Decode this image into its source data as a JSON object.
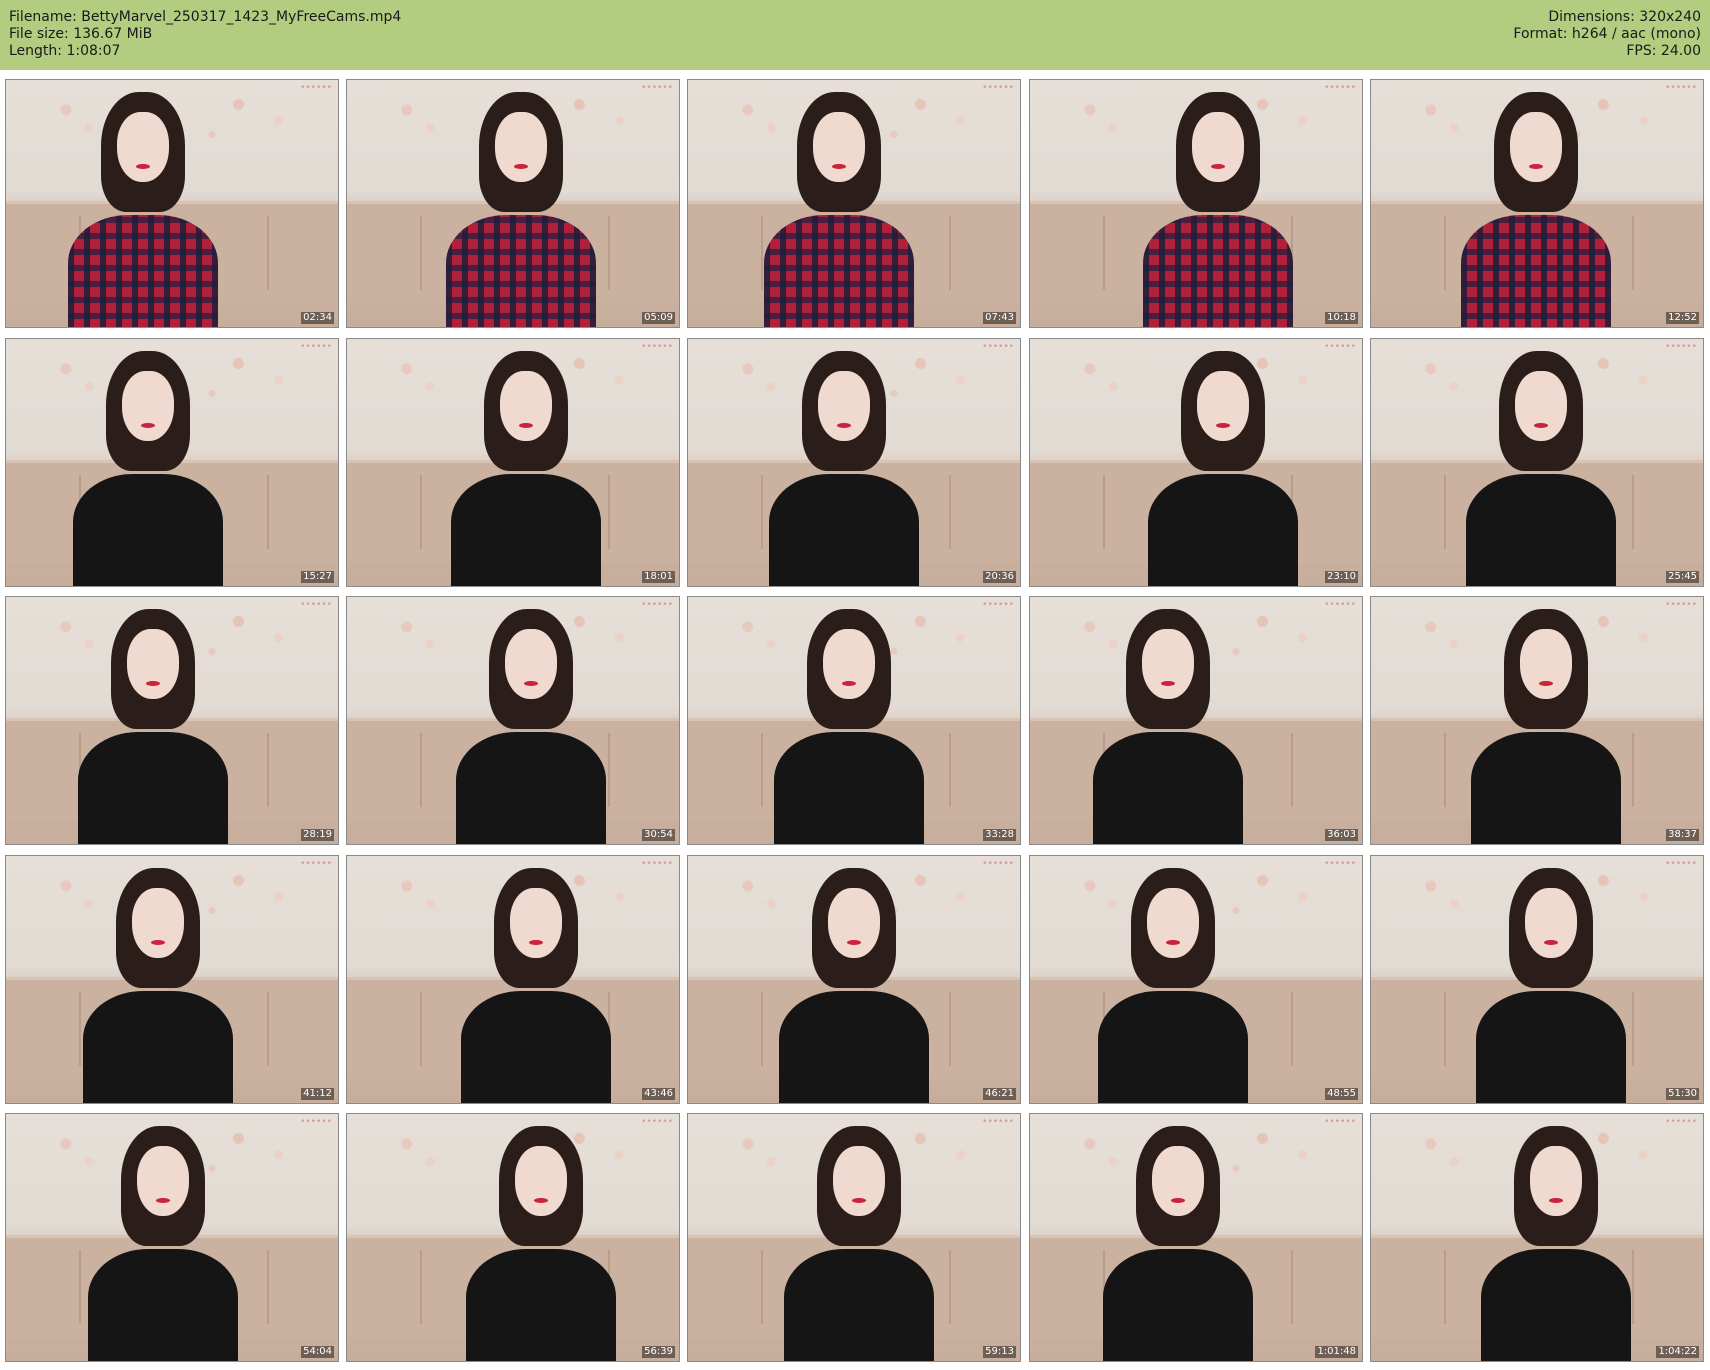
{
  "header": {
    "filename": "Filename: BettyMarvel_250317_1423_MyFreeCams.mp4",
    "file_size": "File size: 136.67 MiB",
    "length": "Length: 1:08:07",
    "dimensions": "Dimensions: 320x240",
    "format": "Format: h264 / aac (mono)",
    "fps": "FPS: 24.00"
  },
  "colors": {
    "header_bg": "#b2cd80",
    "page_bg": "#ffffff"
  },
  "thumbnails": [
    {
      "timestamp": "02:34",
      "outfit": "plaid"
    },
    {
      "timestamp": "05:09",
      "outfit": "plaid"
    },
    {
      "timestamp": "07:43",
      "outfit": "plaid"
    },
    {
      "timestamp": "10:18",
      "outfit": "plaid"
    },
    {
      "timestamp": "12:52",
      "outfit": "plaid"
    },
    {
      "timestamp": "15:27",
      "outfit": "black-top"
    },
    {
      "timestamp": "18:01",
      "outfit": "black-top"
    },
    {
      "timestamp": "20:36",
      "outfit": "black-top"
    },
    {
      "timestamp": "23:10",
      "outfit": "black-top"
    },
    {
      "timestamp": "25:45",
      "outfit": "black-top"
    },
    {
      "timestamp": "28:19",
      "outfit": "black-top"
    },
    {
      "timestamp": "30:54",
      "outfit": "black-top"
    },
    {
      "timestamp": "33:28",
      "outfit": "black-top"
    },
    {
      "timestamp": "36:03",
      "outfit": "black-top"
    },
    {
      "timestamp": "38:37",
      "outfit": "black-top"
    },
    {
      "timestamp": "41:12",
      "outfit": "black-top"
    },
    {
      "timestamp": "43:46",
      "outfit": "black-top"
    },
    {
      "timestamp": "46:21",
      "outfit": "black-top"
    },
    {
      "timestamp": "48:55",
      "outfit": "black-top"
    },
    {
      "timestamp": "51:30",
      "outfit": "black-top"
    },
    {
      "timestamp": "54:04",
      "outfit": "black-top"
    },
    {
      "timestamp": "56:39",
      "outfit": "black-top"
    },
    {
      "timestamp": "59:13",
      "outfit": "black-top"
    },
    {
      "timestamp": "1:01:48",
      "outfit": "black-top"
    },
    {
      "timestamp": "1:04:22",
      "outfit": "black-top"
    }
  ]
}
